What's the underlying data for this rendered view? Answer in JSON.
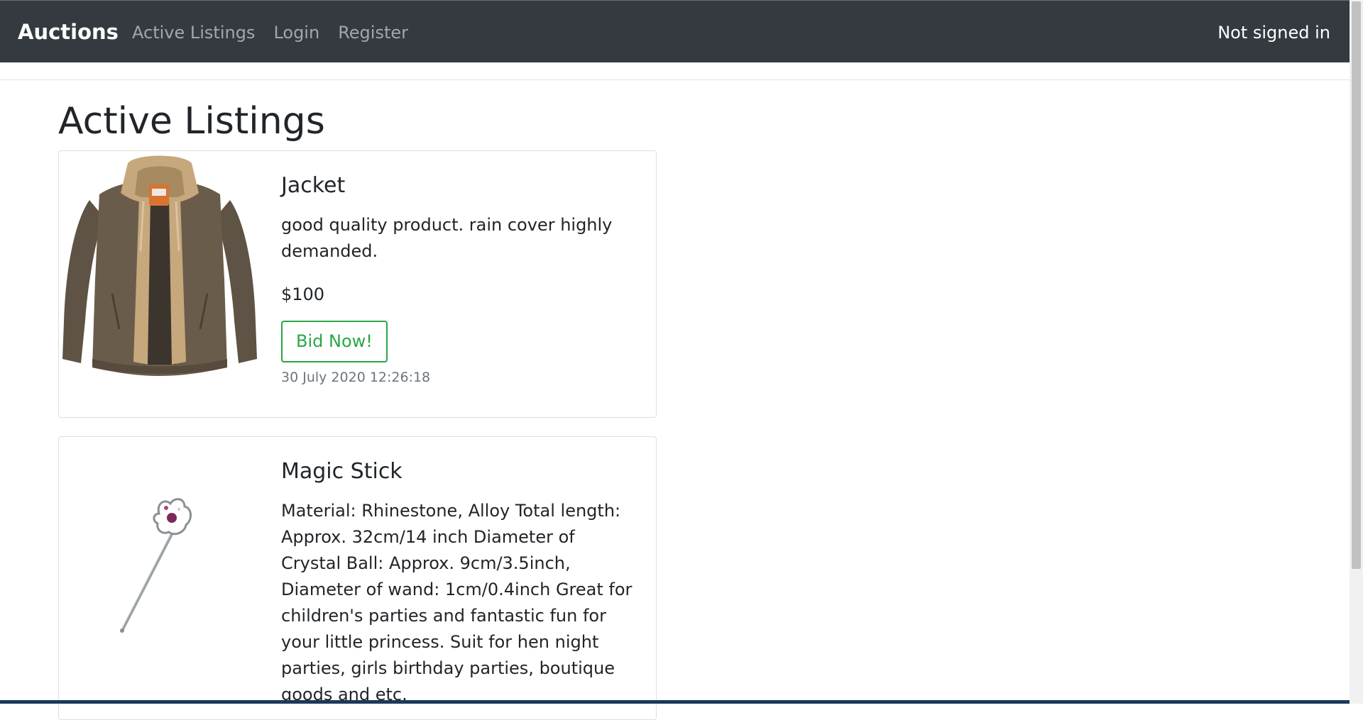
{
  "navbar": {
    "brand": "Auctions",
    "links": [
      "Active Listings",
      "Login",
      "Register"
    ],
    "status": "Not signed in"
  },
  "page": {
    "title": "Active Listings"
  },
  "listings": [
    {
      "title": "Jacket",
      "description": "good quality product. rain cover highly demanded.",
      "price": "$100",
      "bid_label": "Bid Now!",
      "timestamp": "30 July 2020 12:26:18",
      "image": "brown-leather-jacket"
    },
    {
      "title": "Magic Stick",
      "description": "Material: Rhinestone, Alloy Total length: Approx. 32cm/14 inch Diameter of Crystal Ball: Approx. 9cm/3.5inch, Diameter of wand: 1cm/0.4inch Great for children's parties and fantastic fun for your little princess. Suit for hen night parties, girls birthday parties, boutique goods and etc.",
      "image": "princess-wand"
    }
  ],
  "colors": {
    "navbar": "#343a40",
    "success": "#28a745",
    "muted": "#6c757d"
  }
}
